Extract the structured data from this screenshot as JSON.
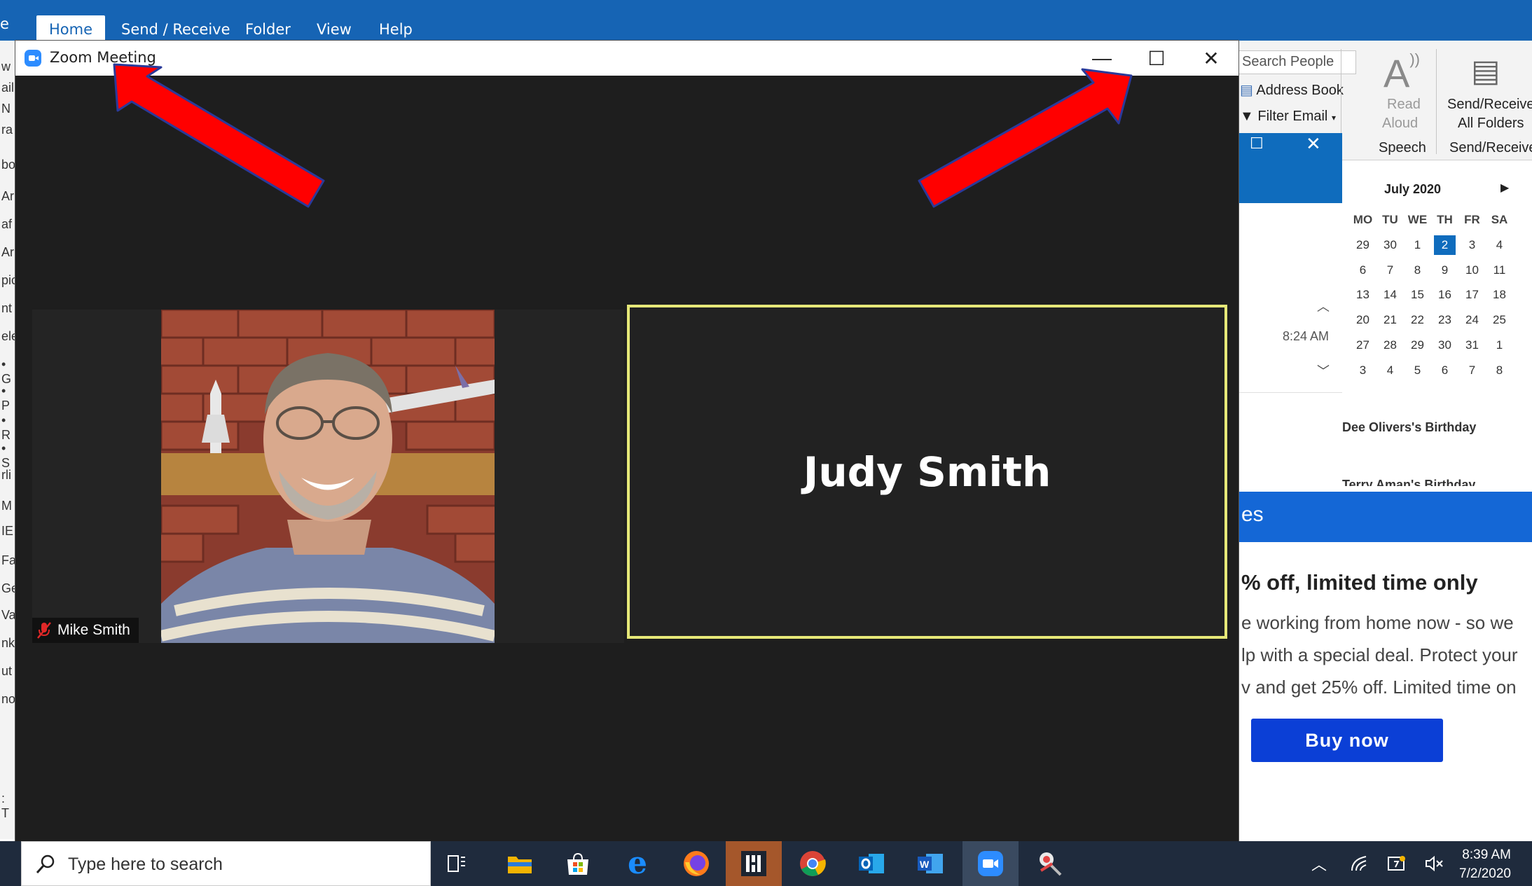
{
  "outlook": {
    "tabs": [
      "Home",
      "Send / Receive",
      "Folder",
      "View",
      "Help"
    ],
    "left_strip": [
      "w",
      "ail",
      "N",
      "ra",
      "bo",
      "Ar",
      "af",
      "Ar",
      "pic",
      "nt",
      "ele",
      "• G",
      "• P",
      "• R",
      "• S",
      "rli",
      "M",
      "IE",
      "Fa",
      "Ge",
      "Va",
      "nk",
      "ut",
      "no",
      ": T"
    ],
    "search_people": "Search People",
    "address_book": "Address Book",
    "filter_email": "Filter Email",
    "read_aloud": [
      "Read",
      "Aloud"
    ],
    "speech_group": "Speech",
    "send_receive_btn": [
      "Send/Receive",
      "All Folders"
    ],
    "send_receive_group": "Send/Receive",
    "peek_time": "8:24 AM",
    "calendar": {
      "month": "July 2020",
      "headers": [
        "MO",
        "TU",
        "WE",
        "TH",
        "FR",
        "SA"
      ],
      "weeks": [
        [
          "29",
          "30",
          "1",
          "2",
          "3",
          "4"
        ],
        [
          "6",
          "7",
          "8",
          "9",
          "10",
          "11"
        ],
        [
          "13",
          "14",
          "15",
          "16",
          "17",
          "18"
        ],
        [
          "20",
          "21",
          "22",
          "23",
          "24",
          "25"
        ],
        [
          "27",
          "28",
          "29",
          "30",
          "31",
          "1"
        ],
        [
          "3",
          "4",
          "5",
          "6",
          "7",
          "8"
        ]
      ],
      "today": "2",
      "events": [
        "Dee Olivers's Birthday",
        "Terry Aman's Birthday"
      ]
    },
    "ad": {
      "band_text": "es",
      "title": "% off, limited time only",
      "lines": [
        "e working from home now - so we",
        "lp with a special deal. Protect your",
        "v and get 25% off. Limited time on"
      ],
      "button": "Buy now"
    }
  },
  "zoom": {
    "window_title": "Zoom Meeting",
    "participants": [
      {
        "name": "Mike Smith",
        "muted": true,
        "video": true
      },
      {
        "name": "Judy Smith",
        "muted": false,
        "video": false
      }
    ]
  },
  "taskbar": {
    "search_placeholder": "Type here to search",
    "time": "8:39 AM",
    "date": "7/2/2020"
  },
  "colors": {
    "outlook_blue": "#1664b4",
    "zoom_bg": "#1e1e1e",
    "active_speaker_border": "#e6e878",
    "arrow_red": "#ff0000",
    "taskbar": "#1f2b3d"
  }
}
